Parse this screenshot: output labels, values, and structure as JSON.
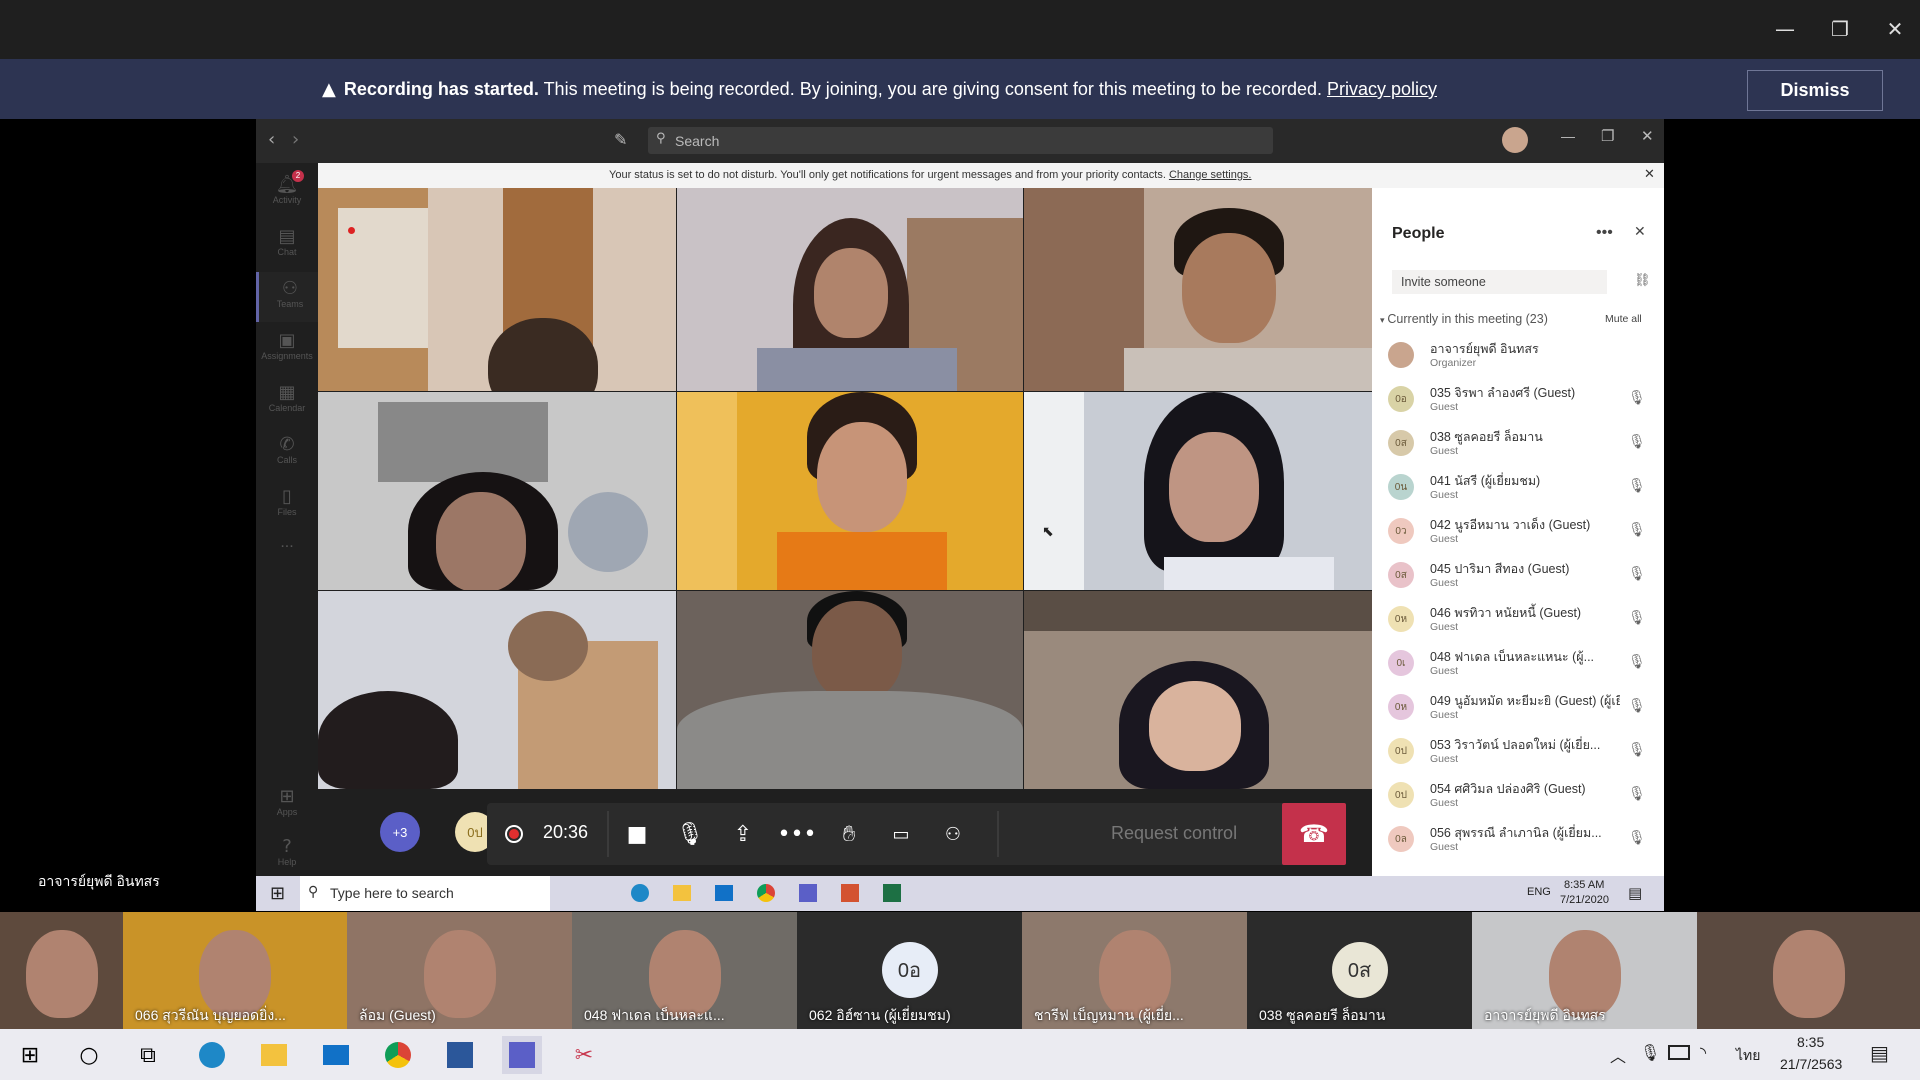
{
  "window": {
    "minimize": "—",
    "restore": "❐",
    "close": "✕"
  },
  "banner": {
    "title": "Recording has started.",
    "message": " This meeting is being recorded. By joining, you are giving consent for this meeting to be recorded. ",
    "link": "Privacy policy",
    "dismiss": "Dismiss",
    "warning_icon": "warning-icon"
  },
  "teams": {
    "search_placeholder": "Search",
    "status_message": "Your status is set to do not disturb. You'll only get notifications for urgent messages and from your priority contacts. ",
    "status_link": "Change settings.",
    "rail": [
      {
        "icon": "bell-icon",
        "label": "Activity",
        "badge": "2"
      },
      {
        "icon": "chat-icon",
        "label": "Chat"
      },
      {
        "icon": "teams-icon",
        "label": "Teams"
      },
      {
        "icon": "assignments-icon",
        "label": "Assignments"
      },
      {
        "icon": "calendar-icon",
        "label": "Calendar"
      },
      {
        "icon": "calls-icon",
        "label": "Calls"
      },
      {
        "icon": "files-icon",
        "label": "Files"
      },
      {
        "icon": "more-icon",
        "label": "..."
      },
      {
        "icon": "apps-icon",
        "label": "Apps"
      },
      {
        "icon": "help-icon",
        "label": "Help"
      }
    ]
  },
  "people": {
    "title": "People",
    "invite_placeholder": "Invite someone",
    "section": "Currently in this meeting (23)",
    "mute_all": "Mute all",
    "members": [
      {
        "name": "อาจารย์ยุพดี อินทสร",
        "role": "Organizer",
        "initials": "",
        "color": "#c9a58e"
      },
      {
        "name": "035 จิรพา ลำองศรี (Guest)",
        "role": "Guest",
        "initials": "0อ",
        "color": "#d9d3a6"
      },
      {
        "name": "038 ซูลคอยรี ล็อมาน",
        "role": "Guest",
        "initials": "0ส",
        "color": "#d7c9a9"
      },
      {
        "name": "041 นัสรี (ผู้เยี่ยมชม)",
        "role": "Guest",
        "initials": "0น",
        "color": "#b9d4cf"
      },
      {
        "name": "042 นูรอีหมาน วาเด็ง (Guest)",
        "role": "Guest",
        "initials": "0ว",
        "color": "#efc9bf"
      },
      {
        "name": "045 ปาริมา สีทอง (Guest)",
        "role": "Guest",
        "initials": "0ส",
        "color": "#e9c2c9"
      },
      {
        "name": "046 พรทิวา หนัยหนี้ (Guest)",
        "role": "Guest",
        "initials": "0ห",
        "color": "#efe1b3"
      },
      {
        "name": "048 ฟาเดล เบ็นหละแหนะ (ผู้...",
        "role": "Guest",
        "initials": "0เ",
        "color": "#e5c6dd"
      },
      {
        "name": "049 นูอัมหมัด หะยีมะยิ (Guest) (ผู้เยี่...",
        "role": "Guest",
        "initials": "0ห",
        "color": "#e5c6dd"
      },
      {
        "name": "053 วิราวัตน์ ปลอดใหม่ (ผู้เยี่ย...",
        "role": "Guest",
        "initials": "0ป",
        "color": "#efe1b3"
      },
      {
        "name": "054 ศศิวิมล ปล่องศิริ (Guest)",
        "role": "Guest",
        "initials": "0ป",
        "color": "#efe1b3"
      },
      {
        "name": "056 สุพรรณี ลำเภานิล (ผู้เยี่ยม...",
        "role": "Guest",
        "initials": "0ล",
        "color": "#efc9bf"
      }
    ]
  },
  "controls": {
    "overflow_count": "+3",
    "self_initials": "0ป",
    "timer": "20:36",
    "request_control": "Request control"
  },
  "presenter_label": "อาจารย์ยุพดี อินทสร",
  "inner_taskbar": {
    "search_placeholder": "Type here to search",
    "lang": "ENG",
    "time": "8:35 AM",
    "date": "7/21/2020"
  },
  "strip": [
    {
      "label": "066 สุวรีณัน บุญยอดยิ่ง...",
      "type": "video"
    },
    {
      "label": "ล้อม (Guest)",
      "type": "video"
    },
    {
      "label": "048 ฟาเดล เบ็นหละแ...",
      "type": "video"
    },
    {
      "label": "062 อิฮ์ซาน (ผู้เยี่ยมชม)",
      "type": "avatar",
      "initials": "0อ"
    },
    {
      "label": "ชารีฟ เบ็ญหมาน (ผู้เยี่ย...",
      "type": "video"
    },
    {
      "label": "038 ซูลคอยรี ล็อมาน",
      "type": "avatar",
      "initials": "0ส"
    },
    {
      "label": "อาจารย์ยุพดี อินทสร",
      "type": "video"
    }
  ],
  "outer_taskbar": {
    "lang": "ไทย",
    "time": "8:35",
    "date": "21/7/2563"
  }
}
